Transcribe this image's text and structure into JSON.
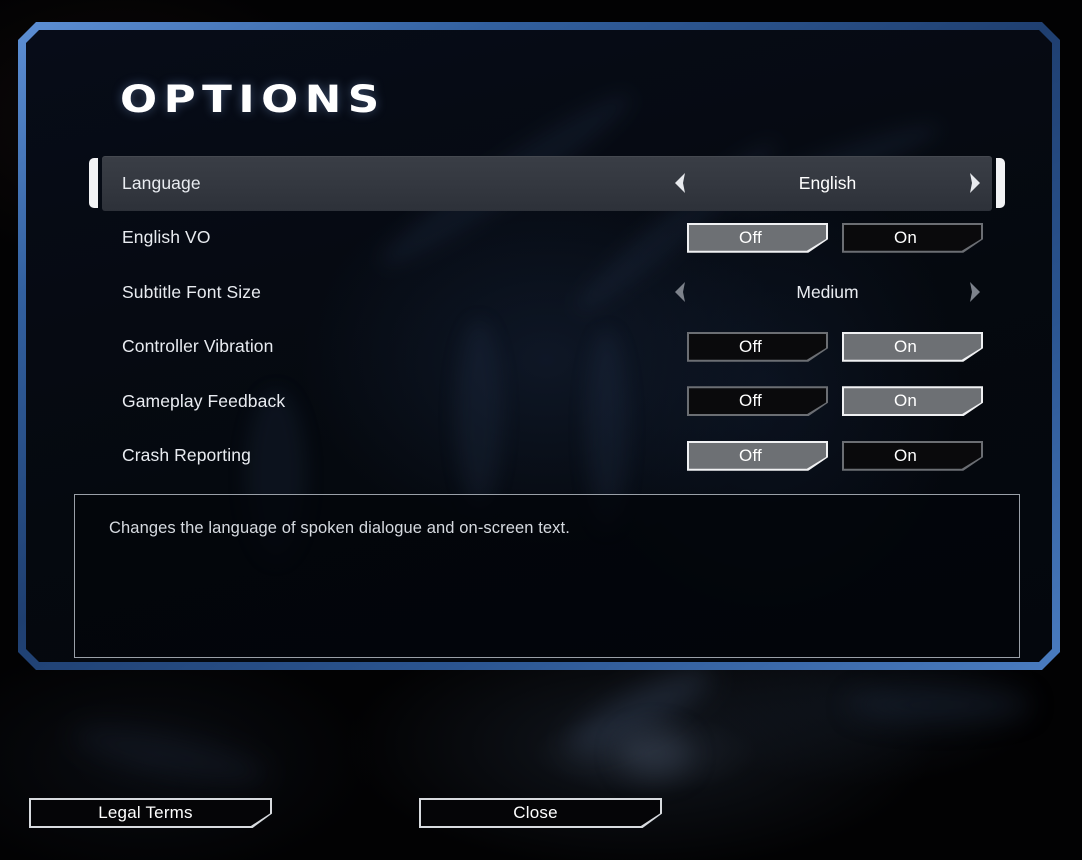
{
  "screen": {
    "title": "OPTIONS"
  },
  "settings": [
    {
      "id": "language",
      "label": "Language",
      "type": "cycler",
      "value": "English",
      "selected": true,
      "left_arrow_icon": "chevron-left-icon",
      "right_arrow_icon": "chevron-right-icon"
    },
    {
      "id": "english-vo",
      "label": "English VO",
      "type": "toggle",
      "off_label": "Off",
      "on_label": "On",
      "value": "Off",
      "selected": false
    },
    {
      "id": "subtitle-font-size",
      "label": "Subtitle Font Size",
      "type": "cycler",
      "value": "Medium",
      "selected": false,
      "left_arrow_icon": "chevron-left-icon",
      "right_arrow_icon": "chevron-right-icon"
    },
    {
      "id": "controller-vibration",
      "label": "Controller Vibration",
      "type": "toggle",
      "off_label": "Off",
      "on_label": "On",
      "value": "On",
      "selected": false
    },
    {
      "id": "gameplay-feedback",
      "label": "Gameplay Feedback",
      "type": "toggle",
      "off_label": "Off",
      "on_label": "On",
      "value": "On",
      "selected": false
    },
    {
      "id": "crash-reporting",
      "label": "Crash Reporting",
      "type": "toggle",
      "off_label": "Off",
      "on_label": "On",
      "value": "Off",
      "selected": false
    }
  ],
  "description": {
    "text": "Changes the language of spoken dialogue and on-screen text."
  },
  "footer": {
    "legal_terms_label": "Legal Terms",
    "close_label": "Close"
  },
  "colors": {
    "panel_glow": "#3a6fb5",
    "selected_row": "#363a43",
    "bracket": "#f2f3f5",
    "toggle_selected_fill": "#6d7074",
    "text": "#e9ecf1"
  }
}
